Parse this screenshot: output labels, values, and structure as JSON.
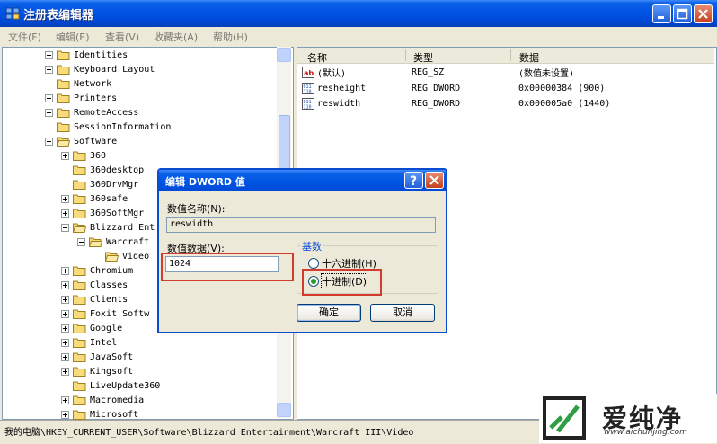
{
  "window": {
    "title": "注册表编辑器"
  },
  "menu": [
    {
      "label": "文件(F)"
    },
    {
      "label": "编辑(E)"
    },
    {
      "label": "查看(V)"
    },
    {
      "label": "收藏夹(A)"
    },
    {
      "label": "帮助(H)"
    }
  ],
  "tree": [
    {
      "label": "Identities",
      "expander": "plus"
    },
    {
      "label": "Keyboard Layout",
      "expander": "plus"
    },
    {
      "label": "Network",
      "expander": "none"
    },
    {
      "label": "Printers",
      "expander": "plus"
    },
    {
      "label": "RemoteAccess",
      "expander": "plus"
    },
    {
      "label": "SessionInformation",
      "expander": "none"
    },
    {
      "label": "Software",
      "expander": "minus"
    },
    {
      "label": "360",
      "expander": "plus"
    },
    {
      "label": "360desktop",
      "expander": "none"
    },
    {
      "label": "360DrvMgr",
      "expander": "none"
    },
    {
      "label": "360safe",
      "expander": "plus"
    },
    {
      "label": "360SoftMgr",
      "expander": "plus"
    },
    {
      "label": "Blizzard Ent",
      "expander": "minus"
    },
    {
      "label": "Warcraft",
      "expander": "minus"
    },
    {
      "label": "Video",
      "expander": "none"
    },
    {
      "label": "Chromium",
      "expander": "plus"
    },
    {
      "label": "Classes",
      "expander": "plus"
    },
    {
      "label": "Clients",
      "expander": "plus"
    },
    {
      "label": "Foxit Softw",
      "expander": "plus"
    },
    {
      "label": "Google",
      "expander": "plus"
    },
    {
      "label": "Intel",
      "expander": "plus"
    },
    {
      "label": "JavaSoft",
      "expander": "plus"
    },
    {
      "label": "Kingsoft",
      "expander": "plus"
    },
    {
      "label": "LiveUpdate360",
      "expander": "none"
    },
    {
      "label": "Macromedia",
      "expander": "plus"
    },
    {
      "label": "Microsoft",
      "expander": "plus"
    }
  ],
  "list": {
    "columns": [
      "名称",
      "类型",
      "数据"
    ],
    "rows": [
      {
        "icon": "string-value-icon",
        "name": "(默认)",
        "type": "REG_SZ",
        "data": "(数值未设置)"
      },
      {
        "icon": "binary-value-icon",
        "name": "resheight",
        "type": "REG_DWORD",
        "data": "0x00000384 (900)"
      },
      {
        "icon": "binary-value-icon",
        "name": "reswidth",
        "type": "REG_DWORD",
        "data": "0x000005a0 (1440)"
      }
    ]
  },
  "status": {
    "path": "我的电脑\\HKEY_CURRENT_USER\\Software\\Blizzard Entertainment\\Warcraft III\\Video"
  },
  "dialog": {
    "title": "编辑 DWORD 值",
    "name_label": "数值名称(N):",
    "name_value": "reswidth",
    "data_label": "数值数据(V):",
    "data_value": "1024",
    "base_label": "基数",
    "hex_label": "十六进制(H)",
    "dec_label": "十进制(D)",
    "selected_base": "dec",
    "ok_label": "确定",
    "cancel_label": "取消"
  },
  "watermark": {
    "brand": "爱纯净",
    "url": "www.aichunjing.com"
  },
  "colors": {
    "accent": "#0054e3",
    "highlight": "#d43b2f",
    "logo": "#2f9e44"
  }
}
